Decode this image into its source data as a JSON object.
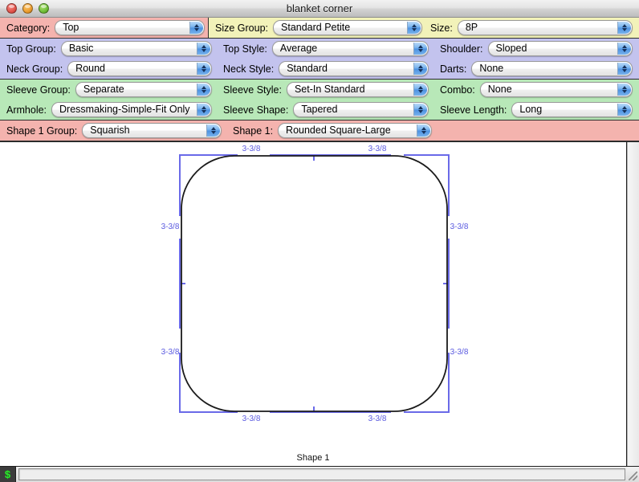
{
  "window": {
    "title": "blanket corner",
    "controls": [
      {
        "name": "close",
        "label": "close"
      },
      {
        "name": "minimize",
        "label": "minimize"
      },
      {
        "name": "zoom",
        "label": "zoom"
      }
    ]
  },
  "colors": {
    "band_category": "#f4b3ae",
    "band_size": "#f2f2b9",
    "band_top": "#c3c3ee",
    "band_sleeve": "#b8e8b8",
    "band_shape": "#f4b3ae",
    "dimension_blue": "#6a6ae8",
    "outline_black": "#1a1a1a",
    "status_icon_green": "#2fe02f"
  },
  "panel": {
    "bands": [
      {
        "name": "category-size-band",
        "segments": [
          {
            "name": "category-segment",
            "color": "#f4b3ae",
            "fields": [
              {
                "label": "Category:",
                "value": "Top",
                "name": "category"
              }
            ]
          },
          {
            "name": "size-segment",
            "color": "#f2f2b9",
            "fields": [
              {
                "label": "Size Group:",
                "value": "Standard Petite",
                "name": "size-group"
              },
              {
                "label": "Size:",
                "value": "8P",
                "name": "size"
              }
            ]
          }
        ]
      },
      {
        "name": "top-band",
        "color": "#c3c3ee",
        "rows": [
          [
            {
              "label": "Top Group:",
              "value": "Basic",
              "name": "top-group"
            },
            {
              "label": "Top Style:",
              "value": "Average",
              "name": "top-style"
            },
            {
              "label": "Shoulder:",
              "value": "Sloped",
              "name": "shoulder"
            }
          ],
          [
            {
              "label": "Neck Group:",
              "value": "Round",
              "name": "neck-group"
            },
            {
              "label": "Neck Style:",
              "value": "Standard",
              "name": "neck-style"
            },
            {
              "label": "Darts:",
              "value": "None",
              "name": "darts"
            }
          ]
        ]
      },
      {
        "name": "sleeve-band",
        "color": "#b8e8b8",
        "rows": [
          [
            {
              "label": "Sleeve Group:",
              "value": "Separate",
              "name": "sleeve-group"
            },
            {
              "label": "Sleeve Style:",
              "value": "Set-In Standard",
              "name": "sleeve-style"
            },
            {
              "label": "Combo:",
              "value": "None",
              "name": "combo"
            }
          ],
          [
            {
              "label": "Armhole:",
              "value": "Dressmaking-Simple-Fit Only",
              "name": "armhole"
            },
            {
              "label": "Sleeve Shape:",
              "value": "Tapered",
              "name": "sleeve-shape"
            },
            {
              "label": "Sleeve Length:",
              "value": "Long",
              "name": "sleeve-length"
            }
          ]
        ]
      },
      {
        "name": "shape-band",
        "color": "#f4b3ae",
        "rows": [
          [
            {
              "label": "Shape 1 Group:",
              "value": "Squarish",
              "name": "shape-1-group"
            },
            {
              "label": "Shape 1:",
              "value": "Rounded Square-Large",
              "name": "shape-1"
            }
          ]
        ]
      }
    ]
  },
  "fields": {
    "category": {
      "label": "Category:",
      "value": "Top"
    },
    "size_group": {
      "label": "Size Group:",
      "value": "Standard Petite"
    },
    "size": {
      "label": "Size:",
      "value": "8P"
    },
    "top_group": {
      "label": "Top Group:",
      "value": "Basic"
    },
    "top_style": {
      "label": "Top Style:",
      "value": "Average"
    },
    "shoulder": {
      "label": "Shoulder:",
      "value": "Sloped"
    },
    "neck_group": {
      "label": "Neck Group:",
      "value": "Round"
    },
    "neck_style": {
      "label": "Neck Style:",
      "value": "Standard"
    },
    "darts": {
      "label": "Darts:",
      "value": "None"
    },
    "sleeve_group": {
      "label": "Sleeve Group:",
      "value": "Separate"
    },
    "sleeve_style": {
      "label": "Sleeve Style:",
      "value": "Set-In Standard"
    },
    "combo": {
      "label": "Combo:",
      "value": "None"
    },
    "armhole": {
      "label": "Armhole:",
      "value": "Dressmaking-Simple-Fit Only"
    },
    "sleeve_shape": {
      "label": "Sleeve Shape:",
      "value": "Tapered"
    },
    "sleeve_length": {
      "label": "Sleeve Length:",
      "value": "Long"
    },
    "shape_1_group": {
      "label": "Shape 1 Group:",
      "value": "Squarish"
    },
    "shape_1": {
      "label": "Shape 1:",
      "value": "Rounded Square-Large"
    }
  },
  "canvas": {
    "caption": "Shape 1",
    "shape_name": "Rounded Square-Large",
    "dimensions": {
      "top_left": "3-3/8",
      "top_right": "3-3/8",
      "bottom_left": "3-3/8",
      "bottom_right": "3-3/8",
      "left_top": "3-3/8",
      "left_bottom": "3-3/8",
      "right_top": "3-3/8",
      "right_bottom": "3-3/8"
    }
  },
  "statusbar": {
    "icon": "money-icon",
    "icon_glyph": "$",
    "message": ""
  }
}
